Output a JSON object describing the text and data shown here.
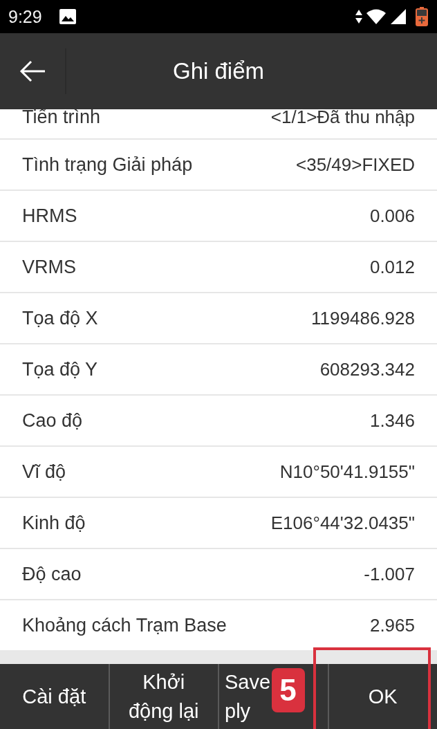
{
  "status_bar": {
    "time": "9:29"
  },
  "app_bar": {
    "title": "Ghi điểm"
  },
  "fields": [
    {
      "label": "Tiến trình",
      "value": "<1/1>Đã thu nhập"
    },
    {
      "label": "Tình trạng Giải pháp",
      "value": "<35/49>FIXED"
    },
    {
      "label": "HRMS",
      "value": "0.006"
    },
    {
      "label": "VRMS",
      "value": "0.012"
    },
    {
      "label": "Tọa độ X",
      "value": "1199486.928"
    },
    {
      "label": "Tọa độ Y",
      "value": "608293.342"
    },
    {
      "label": "Cao độ",
      "value": "1.346"
    },
    {
      "label": "Vĩ độ",
      "value": "N10°50'41.9155\""
    },
    {
      "label": "Kinh độ",
      "value": "E106°44'32.0435\""
    },
    {
      "label": "Độ cao",
      "value": "-1.007"
    },
    {
      "label": "Khoảng cách Trạm Base",
      "value": "2.965"
    }
  ],
  "buttons": [
    {
      "lines": [
        "Cài đặt"
      ],
      "highlighted": false
    },
    {
      "lines": [
        "Khởi",
        "động lại"
      ],
      "highlighted": false
    },
    {
      "lines": [
        "Save",
        "ply"
      ],
      "highlighted": false
    },
    {
      "lines": [
        "OK"
      ],
      "highlighted": true,
      "callout": "5"
    }
  ]
}
